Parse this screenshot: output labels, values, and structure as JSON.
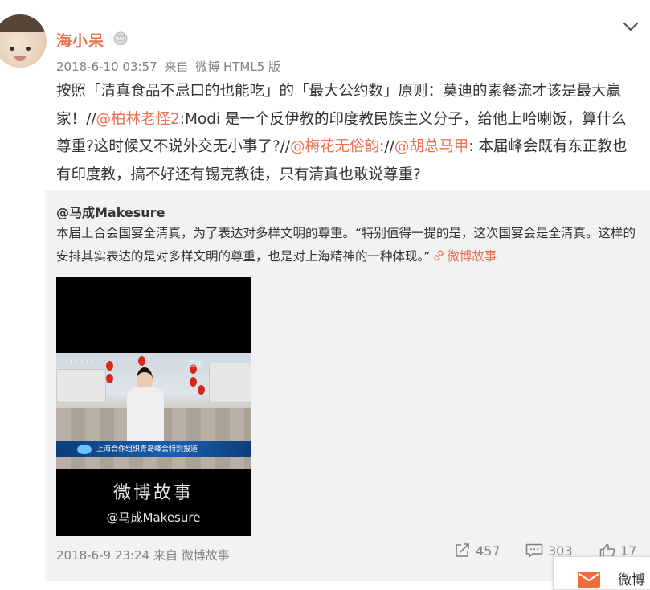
{
  "post": {
    "author": "海小呆",
    "timestamp": "2018-6-10 03:57",
    "via_prefix": "来自",
    "via": "微博 HTML5 版",
    "text_1": "按照「清真食品不忌口的也能吃」的「最大公约数」原则：莫迪的素餐流才该是最大赢家！//",
    "mention_1": "@柏林老怪2",
    "text_2": ":Modi 是一个反伊教的印度教民族主义分子，给他上哈喇饭，算什么尊重?这时候又不说外交无小事了?//",
    "mention_2": "@梅花无俗韵",
    "text_3": "://",
    "mention_3": "@胡总马甲",
    "text_4": ": 本届峰会既有东正教也有印度教，搞不好还有锡克教徒，只有清真也敢说尊重?"
  },
  "repost": {
    "author": "@马成Makesure",
    "text": "本届上合会国宴全清真，为了表达对多样文明的尊重。“特别值得一提的是，这次国宴会是全清真。这样的安排其实表达的是对多样文明的尊重，也是对上海精神的一种体现。”",
    "link_label": "微博故事",
    "video": {
      "ticker": "上海合作组织青岛峰会特别报道",
      "channel": "CCTV 13",
      "live": "直播",
      "watermark": "微博故事",
      "watermark_handle": "@马成Makesure"
    },
    "timestamp": "2018-6-9 23:24",
    "via_prefix": "来自",
    "via": "微博故事",
    "reposts": "457",
    "comments": "303",
    "likes": "17"
  },
  "float_panel": {
    "label": "微博"
  },
  "colors": {
    "accent": "#eb7350",
    "meta_gray": "#808080",
    "repost_bg": "#f2f2f5"
  },
  "icons": {
    "crown": "crown-icon",
    "chevron": "chevron-down-icon",
    "link": "link-icon",
    "repost": "share-icon",
    "comment": "comment-icon",
    "like": "thumbs-up-icon",
    "mail": "mail-icon"
  }
}
